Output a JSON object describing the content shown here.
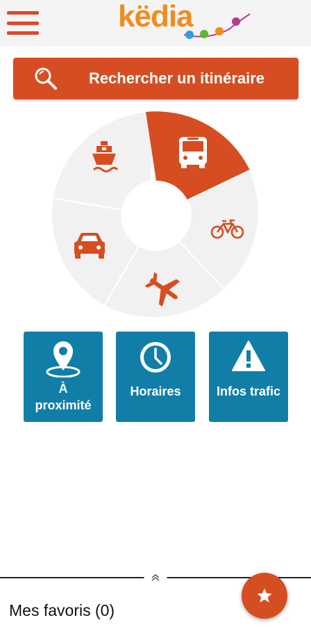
{
  "header": {
    "app_name": "këdia",
    "menu_icon": "hamburger-icon"
  },
  "search": {
    "label": "Rechercher un itinéraire",
    "icon": "search-icon"
  },
  "modes": [
    {
      "name": "bus",
      "icon": "bus-icon",
      "active": true
    },
    {
      "name": "bike",
      "icon": "bike-icon",
      "active": false
    },
    {
      "name": "plane",
      "icon": "plane-icon",
      "active": false
    },
    {
      "name": "car",
      "icon": "car-icon",
      "active": false
    },
    {
      "name": "ship",
      "icon": "ship-icon",
      "active": false
    }
  ],
  "tiles": [
    {
      "label_line1": "À",
      "label_line2": "proximité",
      "icon": "location-pin-icon"
    },
    {
      "label": "Horaires",
      "icon": "clock-icon"
    },
    {
      "label": "Infos trafic",
      "icon": "warning-icon"
    }
  ],
  "favorites": {
    "label": "Mes favoris (0)",
    "fab_icon": "star-icon"
  },
  "colors": {
    "accent": "#d64d22",
    "tile": "#117ea8",
    "wheel": "#f1f1f1"
  }
}
